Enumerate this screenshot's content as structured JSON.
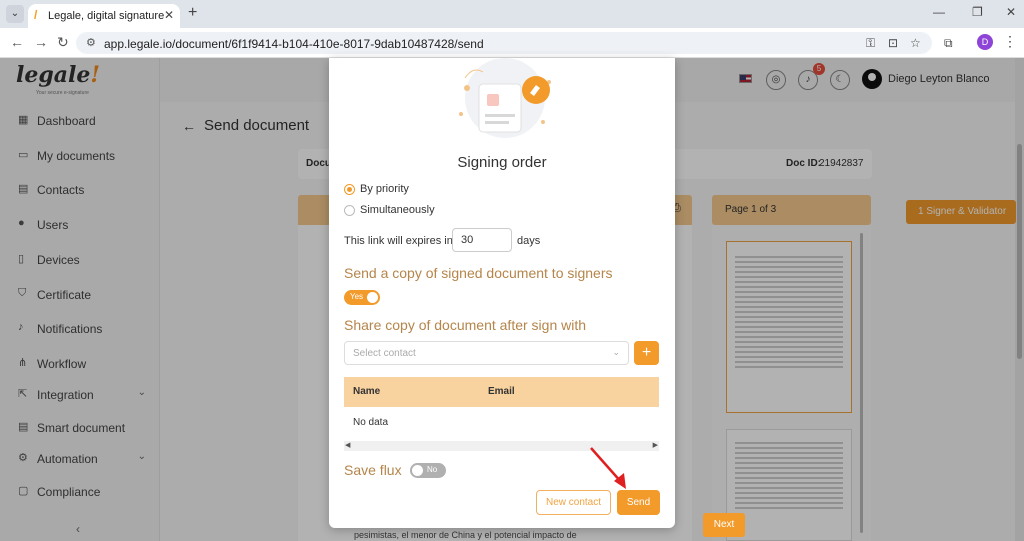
{
  "browser": {
    "tab_title": "Legale, digital signature",
    "url": "app.legale.io/document/6f1f9414-b104-410e-8017-9dab10487428/send",
    "profile_initial": "D"
  },
  "app": {
    "logo": "legale",
    "logo_accent": "!",
    "logo_tagline": "Your secure e-signature",
    "accent_color": "#f29a2a",
    "sidebar": {
      "items": [
        {
          "label": "Dashboard",
          "icon": "dashboard-icon"
        },
        {
          "label": "My documents",
          "icon": "folder-icon"
        },
        {
          "label": "Contacts",
          "icon": "contacts-icon"
        },
        {
          "label": "Users",
          "icon": "user-icon"
        },
        {
          "label": "Devices",
          "icon": "device-icon"
        },
        {
          "label": "Certificate",
          "icon": "shield-icon"
        },
        {
          "label": "Notifications",
          "icon": "bell-icon"
        },
        {
          "label": "Workflow",
          "icon": "workflow-icon"
        },
        {
          "label": "Integration",
          "icon": "integration-icon"
        },
        {
          "label": "Smart document",
          "icon": "smart-document-icon"
        },
        {
          "label": "Automation",
          "icon": "gear-icon"
        },
        {
          "label": "Compliance",
          "icon": "compliance-icon"
        }
      ],
      "collapse_label": "‹"
    },
    "header": {
      "notification_count": "5",
      "user_name": "Diego Leyton Blanco"
    },
    "page_title": "Send document",
    "doc_label": "Docu",
    "doc_id_label": "Doc ID:",
    "doc_id_value": "21942837",
    "pager_text": "Page 1 of 3",
    "signer_button": "1 Signer & Validator",
    "next_button": "Next",
    "under_text": "pesimistas, el menor de China y el potencial impacto de"
  },
  "modal": {
    "title": "Signing order",
    "options": [
      {
        "label": "By priority",
        "selected": true
      },
      {
        "label": "Simultaneously",
        "selected": false
      }
    ],
    "expire_label": "This link will expires in",
    "expire_value": "30",
    "expire_unit": "days",
    "send_copy_heading": "Send a copy of signed document to signers",
    "send_copy_toggle": "Yes",
    "share_heading": "Share copy of document after sign with",
    "select_placeholder": "Select contact",
    "add_label": "+",
    "table": {
      "columns": [
        "Name",
        "Email"
      ],
      "empty_text": "No data"
    },
    "save_flux_label": "Save flux",
    "save_flux_toggle": "No",
    "new_contact_button": "New contact",
    "send_button": "Send"
  }
}
